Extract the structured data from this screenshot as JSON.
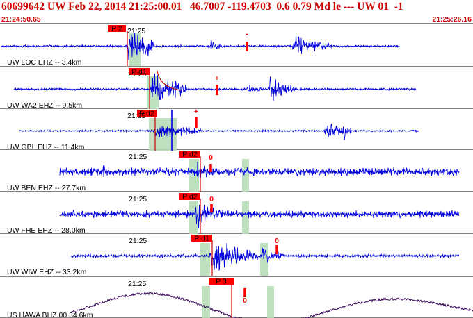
{
  "header": {
    "title": "60699642 UW Feb 22, 2014 21:25:00.01   46.7007 -119.4703  0.6 0.79 Md le --- UW 01  -1",
    "start_time": "21:24:50.65",
    "end_time": "21:25:26.16"
  },
  "colors": {
    "header_text": "#cc0000",
    "trace": "#0000dd",
    "broadband_trace": "#330055",
    "pick_box": "#ff0000",
    "pick_text": "#000000",
    "marker": "#ff0000",
    "s_window": "#b8ddb8",
    "separator": "#000000",
    "p_line": "#cc0000"
  },
  "panels": [
    {
      "station_label": "UW LOC EHZ -- 3.4km",
      "minute_label": "21:25",
      "pick_label": "P 2",
      "amp_symbol": "-"
    },
    {
      "station_label": "UW WA2 EHZ -- 9.5km",
      "minute_label": "21:25",
      "pick_label": "P d1",
      "amp_symbol": "+"
    },
    {
      "station_label": "UW GBL EHZ -- 11.4km",
      "minute_label": "21:25",
      "pick_label": "P d2",
      "amp_symbol": "+"
    },
    {
      "station_label": "UW BEN EHZ -- 27.7km",
      "minute_label": "21:25",
      "pick_label": "P d2",
      "amp_symbol": "0"
    },
    {
      "station_label": "UW FHE EHZ -- 28.0km",
      "minute_label": "21:25",
      "pick_label": "P d2",
      "amp_symbol": "0"
    },
    {
      "station_label": "UW WIW EHZ -- 33.2km",
      "minute_label": "21:25",
      "pick_label": "P d1",
      "amp_symbol": "0"
    },
    {
      "station_label": "US HAWA BHZ 00 34.6km",
      "minute_label": "21:25",
      "pick_label": "P 3",
      "amp_symbol": "0"
    }
  ]
}
